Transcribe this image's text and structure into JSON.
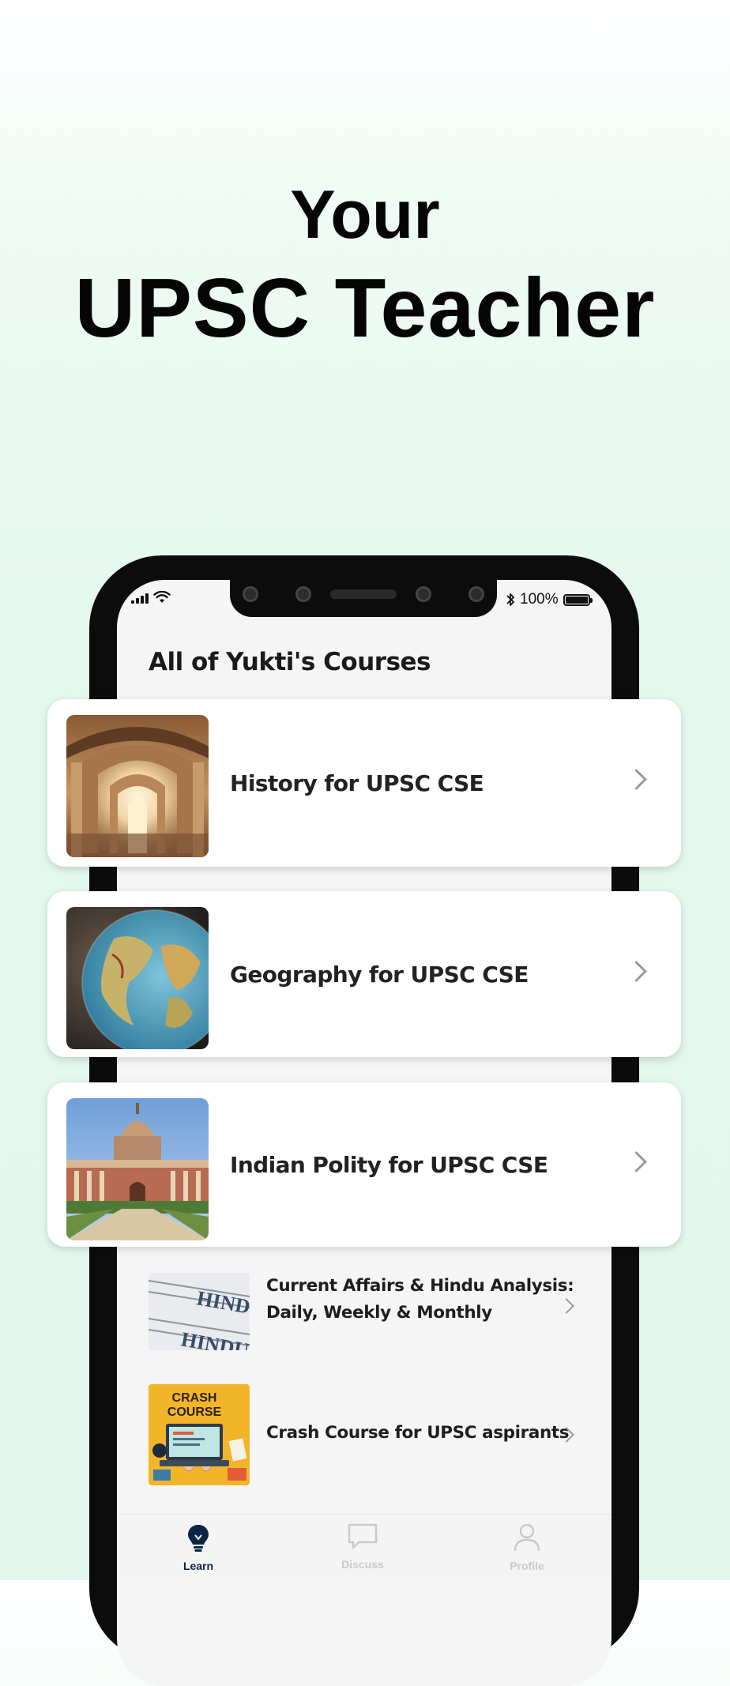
{
  "headline": {
    "line1": "Your",
    "line2": "UPSC Teacher"
  },
  "status_bar": {
    "battery_text": "100%",
    "icons": [
      "signal-icon",
      "wifi-icon",
      "bluetooth-icon",
      "battery-icon"
    ]
  },
  "screen": {
    "title": "All of Yukti's Courses"
  },
  "featured_courses": [
    {
      "title": "History for UPSC CSE",
      "image": "archway-colonnade-photo"
    },
    {
      "title": "Geography for UPSC CSE",
      "image": "globe-photo"
    },
    {
      "title": "Indian Polity for UPSC CSE",
      "image": "parliament-building-photo"
    }
  ],
  "courses": [
    {
      "title_line1": "Current Affairs & Hindu Analysis:",
      "title_line2": "Daily, Weekly & Monthly",
      "image": "newspaper-photo"
    },
    {
      "title": "Crash Course for UPSC aspirants",
      "image": "crash-course-illustration",
      "image_text_1": "CRASH",
      "image_text_2": "COURSE"
    }
  ],
  "tabs": [
    {
      "label": "Learn",
      "icon": "lightbulb-icon",
      "active": true
    },
    {
      "label": "Discuss",
      "icon": "chat-bubble-icon",
      "active": false
    },
    {
      "label": "Profile",
      "icon": "person-icon",
      "active": false
    }
  ],
  "colors": {
    "background": "#e2f7ed",
    "active_tab": "#0f2444",
    "inactive_tab": "#cacaca",
    "crash_course_yellow": "#f2b52a"
  }
}
